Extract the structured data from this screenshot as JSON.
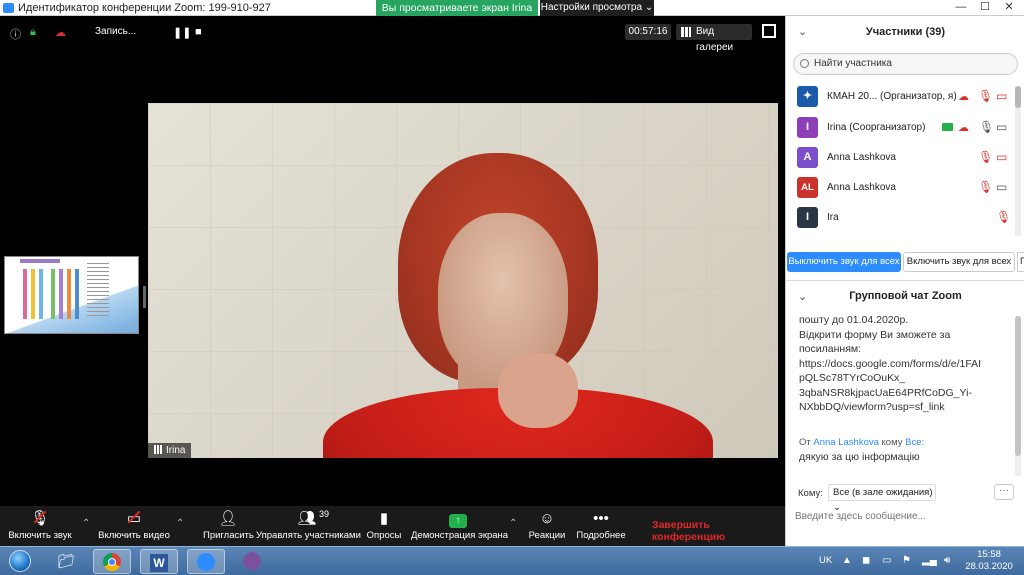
{
  "window": {
    "title": "Идентификатор конференции Zoom: 199-910-927",
    "share_banner": "Вы просматриваете экран Irina",
    "view_options": "Настройки просмотра",
    "view_options_caret": "⌄",
    "minimize": "—",
    "maximize": "☐",
    "close": "✕"
  },
  "meeting": {
    "recording_label": "Запись...",
    "timer": "00:57:16",
    "gallery_label": "Вид галереи",
    "speaker_name": "Irina"
  },
  "toolbar": {
    "unmute": "Включить звук",
    "start_video": "Включить видео",
    "invite": "Пригласить",
    "manage_participants": "Управлять участниками",
    "participants_count": "39",
    "polls": "Опросы",
    "share_screen": "Демонстрация экрана",
    "reactions": "Реакции",
    "more": "Подробнее",
    "end_meeting": "Завершить конференцию"
  },
  "participants": {
    "header": "Участники (39)",
    "search_placeholder": "Найти участника",
    "list": [
      {
        "name": "КМАН 20...  (Организатор, я)",
        "avatar": "✦",
        "color": "#1a5aa8"
      },
      {
        "name": "Irina (Соорганизатор)",
        "avatar": "I",
        "color": "#8e3fb8"
      },
      {
        "name": "Anna Lashkova",
        "avatar": "A",
        "color": "#7b4fc9"
      },
      {
        "name": "Anna Lashkova",
        "avatar": "AL",
        "color": "#c9332c"
      },
      {
        "name": "Ira",
        "avatar": "I",
        "color": "#2b3644"
      }
    ],
    "mute_all": "Выключить звук для всех",
    "unmute_all": "Включить звук для всех",
    "more": "П"
  },
  "chat": {
    "header": "Групповой чат Zoom",
    "message_lines": [
      "пошту до 01.04.2020р.",
      "Відкрити форму Ви зможете за",
      "посиланням:",
      "https://docs.google.com/forms/d/e/1FAI",
      "pQLSc78TYrCoOuKx_",
      "3qbaNSR8kjpacUaE64PRfCoDG_Yi-",
      "NXbbDQ/viewform?usp=sf_link"
    ],
    "from_prefix": "От",
    "from_name": "Anna Lashkova",
    "to_word": "кому",
    "to_name": "Все:",
    "message2": "дякую за цю інформацію",
    "to_label": "Кому:",
    "to_value": "Все (в зале ожидания)",
    "input_placeholder": "Введите здесь сообщение..."
  },
  "taskbar": {
    "lang": "UK",
    "time": "15:58",
    "date": "28.03.2020"
  }
}
